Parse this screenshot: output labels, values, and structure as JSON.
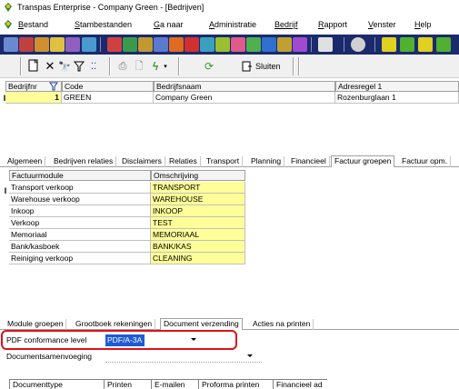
{
  "window": {
    "title": "Transpas Enterprise - Company Green - [Bedrijven]"
  },
  "menu": {
    "items": [
      {
        "first": "B",
        "rest": "estand"
      },
      {
        "first": "S",
        "rest": "tambestanden"
      },
      {
        "first": "G",
        "rest": "a naar"
      },
      {
        "first": "A",
        "rest": "dministratie"
      },
      {
        "first": "",
        "rest": "Bedrijf"
      },
      {
        "first": "R",
        "rest": "apport"
      },
      {
        "first": "V",
        "rest": "enster"
      },
      {
        "first": "H",
        "rest": "elp"
      }
    ]
  },
  "toolbar": {
    "sluiten_label": "Sluiten"
  },
  "companies": {
    "columns": [
      "Bedrijfnr",
      "Code",
      "Bedrijfsnaam",
      "Adresregel 1"
    ],
    "rows": [
      {
        "nr": "1",
        "code": "GREEN",
        "naam": "Company Green",
        "adres": "Rozenburglaan 1"
      }
    ]
  },
  "tabs": [
    "Algemeen",
    "Bedrijven relaties",
    "Disclaimers",
    "Relaties",
    "Transport",
    "Planning",
    "Financieel",
    "Factuur groepen",
    "Factuur opm."
  ],
  "active_tab": "Factuur groepen",
  "invoice_groups": {
    "columns": [
      "Factuurmodule",
      "Omschrijving"
    ],
    "rows": [
      {
        "module": "Transport verkoop",
        "desc": "TRANSPORT"
      },
      {
        "module": "Warehouse verkoop",
        "desc": "WAREHOUSE"
      },
      {
        "module": "Inkoop",
        "desc": "INKOOP"
      },
      {
        "module": "Verkoop",
        "desc": "TEST"
      },
      {
        "module": "Memoriaal",
        "desc": "MEMORIAAL"
      },
      {
        "module": "Bank/kasboek",
        "desc": "BANK/KAS"
      },
      {
        "module": "Reiniging verkoop",
        "desc": "CLEANING"
      }
    ]
  },
  "subtabs": [
    "Module groepen",
    "Grootboek rekeningen",
    "Document verzending",
    "Acties na printen"
  ],
  "active_subtab": "Document verzending",
  "document": {
    "pdf_label": "PDF conformance level",
    "pdf_value": "PDF/A-3A",
    "samenvoeging_label": "Documentsamenvoeging",
    "samenvoeging_value": ""
  },
  "bottom_columns": [
    "Documenttype",
    "Printen",
    "E-mailen",
    "Proforma printen",
    "Financieel ad"
  ],
  "colors": {
    "highlight": "#e0101a",
    "yellow": "#ffff99",
    "selection": "#1e5bd4"
  }
}
